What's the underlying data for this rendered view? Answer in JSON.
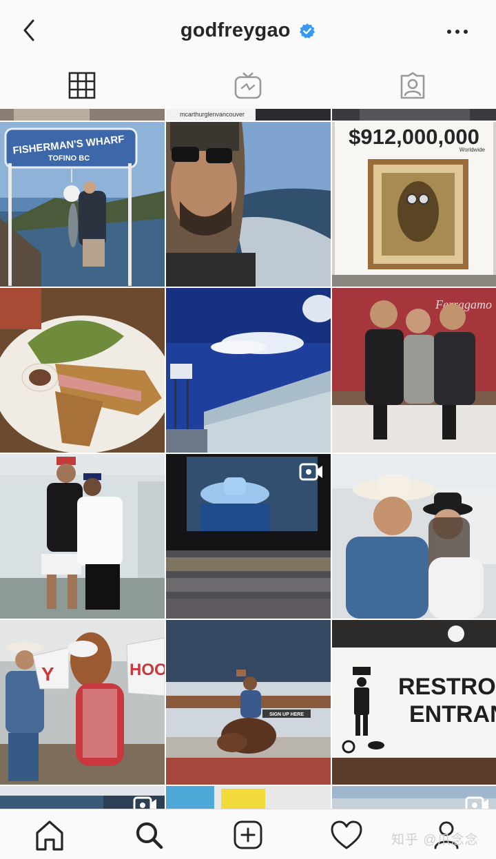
{
  "header": {
    "title": "godfreygao",
    "verified": true,
    "back_icon": "chevron-left-icon",
    "more_icon": "more-horizontal-icon"
  },
  "tabs": [
    {
      "name": "grid",
      "icon": "grid-icon",
      "active": true
    },
    {
      "name": "igtv",
      "icon": "igtv-icon",
      "active": false
    },
    {
      "name": "tagged",
      "icon": "tagged-user-icon",
      "active": false
    }
  ],
  "posts": {
    "top_strip_tag": "mcarthurglenvancouver",
    "items": [
      {
        "id": "fisherman-wharf",
        "sign_line1": "FISHERMAN'S WHARF",
        "sign_line2": "TOFINO BC",
        "video": false
      },
      {
        "id": "boat-selfie",
        "video": false
      },
      {
        "id": "minion-lisa",
        "price": "$912,000,000",
        "caption": "Worldwide",
        "video": false
      },
      {
        "id": "sandwich-plate",
        "video": false
      },
      {
        "id": "sky-water-tower",
        "video": false
      },
      {
        "id": "three-men-event",
        "backdrop_text": "Ferragamo",
        "video": false
      },
      {
        "id": "two-men-cap",
        "video": false
      },
      {
        "id": "rodeo-screen",
        "video": true
      },
      {
        "id": "cowboy-hat-selfie",
        "video": false
      },
      {
        "id": "horse-mascot",
        "sign_left": "Y",
        "sign_right": "HOO",
        "video": false
      },
      {
        "id": "bull-ride",
        "banner": "SIGN UP HERE",
        "video": false
      },
      {
        "id": "restroom-sign",
        "line1": "RESTRO",
        "line2": "ENTRAN",
        "video": false
      }
    ]
  },
  "bottom_nav": [
    {
      "name": "home",
      "icon": "home-icon"
    },
    {
      "name": "search",
      "icon": "search-icon",
      "active": true
    },
    {
      "name": "new-post",
      "icon": "add-post-icon"
    },
    {
      "name": "activity",
      "icon": "heart-icon"
    },
    {
      "name": "profile",
      "icon": "profile-icon"
    }
  ],
  "watermark": "知乎 @爪念念",
  "colors": {
    "verified_blue": "#3897f0",
    "icon_dark": "#262626",
    "icon_inactive": "#999999",
    "background": "#fafafa"
  }
}
